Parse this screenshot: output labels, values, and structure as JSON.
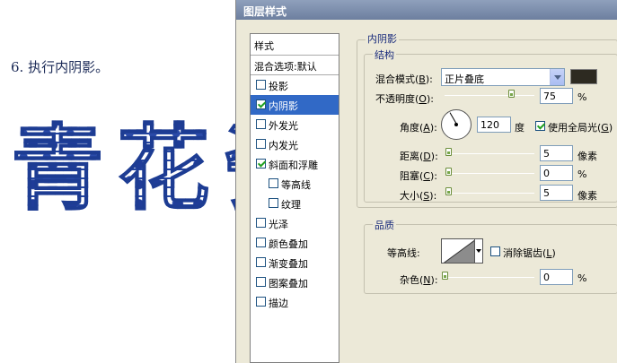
{
  "tutorial": {
    "step_text": "6. 执行内阴影。",
    "art_chars": [
      "青",
      "花",
      "瓷"
    ]
  },
  "dialog": {
    "title": "图层样式",
    "style_list": {
      "header": "样式",
      "blend_options": "混合选项:默认",
      "items": [
        {
          "label": "投影",
          "checked": false,
          "selected": false,
          "indent": false
        },
        {
          "label": "内阴影",
          "checked": true,
          "selected": true,
          "indent": false
        },
        {
          "label": "外发光",
          "checked": false,
          "selected": false,
          "indent": false
        },
        {
          "label": "内发光",
          "checked": false,
          "selected": false,
          "indent": false
        },
        {
          "label": "斜面和浮雕",
          "checked": true,
          "selected": false,
          "indent": false
        },
        {
          "label": "等高线",
          "checked": false,
          "selected": false,
          "indent": true
        },
        {
          "label": "纹理",
          "checked": false,
          "selected": false,
          "indent": true
        },
        {
          "label": "光泽",
          "checked": false,
          "selected": false,
          "indent": false
        },
        {
          "label": "颜色叠加",
          "checked": false,
          "selected": false,
          "indent": false
        },
        {
          "label": "渐变叠加",
          "checked": false,
          "selected": false,
          "indent": false
        },
        {
          "label": "图案叠加",
          "checked": false,
          "selected": false,
          "indent": false
        },
        {
          "label": "描边",
          "checked": false,
          "selected": false,
          "indent": false
        }
      ]
    },
    "inner_shadow": {
      "section_title": "内阴影",
      "structure_title": "结构",
      "blend_mode_label": "混合模式(",
      "blend_mode_key": "B",
      "blend_mode_value": "正片叠底",
      "shadow_color": "#2d2a21",
      "opacity_label": "不透明度(",
      "opacity_key": "O",
      "opacity_value": "75",
      "opacity_unit": "%",
      "opacity_fraction": 0.75,
      "angle_label": "角度(",
      "angle_key": "A",
      "angle_value": "120",
      "angle_unit": "度",
      "global_light_label": "使用全局光(",
      "global_light_key": "G",
      "global_light_checked": true,
      "distance_label": "距离(",
      "distance_key": "D",
      "distance_value": "5",
      "distance_unit": "像素",
      "choke_label": "阻塞(",
      "choke_key": "C",
      "choke_value": "0",
      "choke_unit": "%",
      "size_label": "大小(",
      "size_key": "S",
      "size_value": "5",
      "size_unit": "像素"
    },
    "quality": {
      "title": "品质",
      "contour_label": "等高线:",
      "antialias_label": "消除锯齿(",
      "antialias_key": "L",
      "antialias_checked": false,
      "noise_label": "杂色(",
      "noise_key": "N",
      "noise_value": "0",
      "noise_unit": "%"
    }
  }
}
